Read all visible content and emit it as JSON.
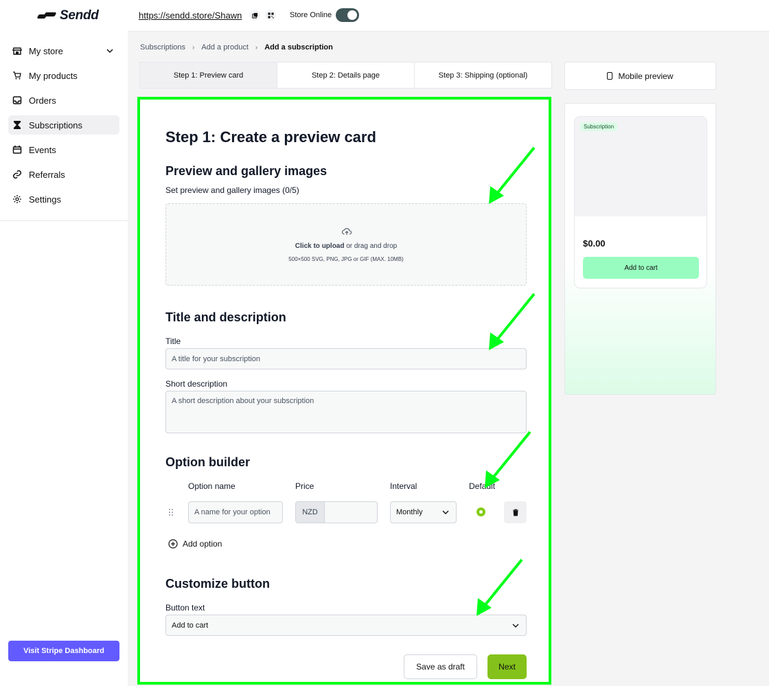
{
  "brand": {
    "name": "Sendd"
  },
  "sidebar": {
    "items": [
      {
        "label": "My store",
        "icon": "store-icon"
      },
      {
        "label": "My products",
        "icon": "cart-icon"
      },
      {
        "label": "Orders",
        "icon": "inbox-icon"
      },
      {
        "label": "Subscriptions",
        "icon": "hourglass-icon",
        "active": true
      },
      {
        "label": "Events",
        "icon": "calendar-icon"
      },
      {
        "label": "Referrals",
        "icon": "link-icon"
      },
      {
        "label": "Settings",
        "icon": "gear-icon"
      }
    ],
    "stripe_button": "Visit Stripe Dashboard"
  },
  "topbar": {
    "store_url": "https://sendd.store/Shawn",
    "store_online_label": "Store Online",
    "store_online": true
  },
  "breadcrumb": {
    "items": [
      "Subscriptions",
      "Add a product"
    ],
    "current": "Add a subscription"
  },
  "steps": [
    {
      "label": "Step 1: Preview card",
      "active": true
    },
    {
      "label": "Step 2: Details page"
    },
    {
      "label": "Step 3: Shipping (optional)"
    }
  ],
  "form": {
    "heading": "Step 1: Create a preview card",
    "gallery": {
      "heading": "Preview and gallery images",
      "label": "Set preview and gallery images (0/5)",
      "upload_bold": "Click to upload",
      "upload_rest": " or drag and drop",
      "upload_hint": "500×500 SVG, PNG, JPG or GIF (MAX. 10MB)"
    },
    "title_desc": {
      "heading": "Title and description",
      "title_label": "Title",
      "title_placeholder": "A title for your subscription",
      "desc_label": "Short description",
      "desc_placeholder": "A short description about your subscription"
    },
    "options": {
      "heading": "Option builder",
      "col_name": "Option name",
      "col_price": "Price",
      "col_interval": "Interval",
      "col_default": "Default",
      "row": {
        "name_placeholder": "A name for your option",
        "currency": "NZD",
        "interval": "Monthly"
      },
      "add_label": "Add option"
    },
    "customize": {
      "heading": "Customize button",
      "button_text_label": "Button text",
      "button_text_value": "Add to cart"
    },
    "actions": {
      "draft": "Save as draft",
      "next": "Next"
    }
  },
  "preview": {
    "mobile_label": "Mobile preview",
    "badge": "Subscription",
    "price": "$0.00",
    "add_label": "Add to cart"
  },
  "colors": {
    "highlight": "#00ff1a",
    "next_button": "#84c21b",
    "stripe_button": "#635bff",
    "preview_button": "#98fcc0",
    "default_radio": "#84cc16"
  }
}
